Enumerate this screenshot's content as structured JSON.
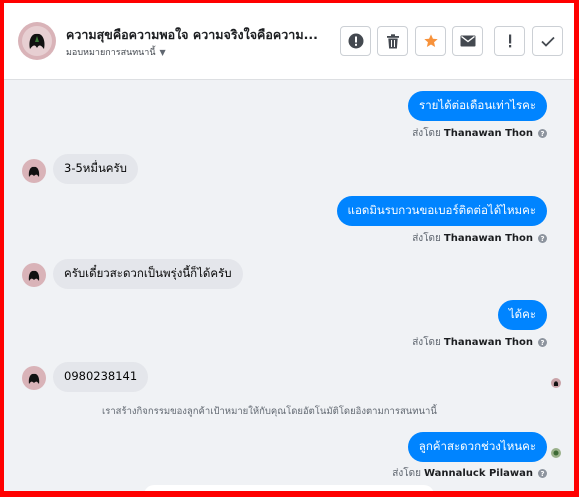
{
  "header": {
    "title": "ความสุขคือความพอใจ ความจริงใจคือความ...",
    "assign_label": "มอบหมายการสนทนานี้",
    "buttons": [
      {
        "name": "alert-button",
        "icon": "exclamation-circle-icon"
      },
      {
        "name": "delete-button",
        "icon": "trash-icon"
      },
      {
        "name": "star-button",
        "icon": "star-icon",
        "color": "#f7923b"
      },
      {
        "name": "email-button",
        "icon": "envelope-icon"
      },
      {
        "name": "spam-button",
        "icon": "exclamation-icon"
      },
      {
        "name": "done-button",
        "icon": "check-icon"
      }
    ]
  },
  "messages": [
    {
      "dir": "out",
      "text": "รายได้ต่อเดือนเท่าไรคะ",
      "sent_by_prefix": "ส่งโดย",
      "sent_by": "Thanawan Thon"
    },
    {
      "dir": "in",
      "text": "3-5หมื่นครับ"
    },
    {
      "dir": "out",
      "text": "แอดมินรบกวนขอเบอร์ติดต่อได้ไหมคะ",
      "sent_by_prefix": "ส่งโดย",
      "sent_by": "Thanawan Thon"
    },
    {
      "dir": "in",
      "text": "ครับเดี๋ยวสะดวกเป็นพรุ่งนี้ก็ได้ครับ"
    },
    {
      "dir": "out",
      "text": "ได้คะ",
      "sent_by_prefix": "ส่งโดย",
      "sent_by": "Thanawan Thon"
    },
    {
      "dir": "in",
      "text": "0980238141"
    },
    {
      "dir": "system",
      "text": "เราสร้างกิจกรรมของลูกค้าเป้าหมายให้กับคุณโดยอัตโนมัติโดยอิงตามการสนทนานี้"
    },
    {
      "dir": "out",
      "text": "ลูกค้าสะดวกช่วงไหนคะ",
      "sent_by_prefix": "ส่งโดย",
      "sent_by": "Wannaluck Pilawan"
    }
  ],
  "colors": {
    "frame": "#ff0000",
    "outgoing_bubble": "#0084ff",
    "incoming_bubble": "#e4e6eb",
    "background": "#f0f2f5"
  }
}
